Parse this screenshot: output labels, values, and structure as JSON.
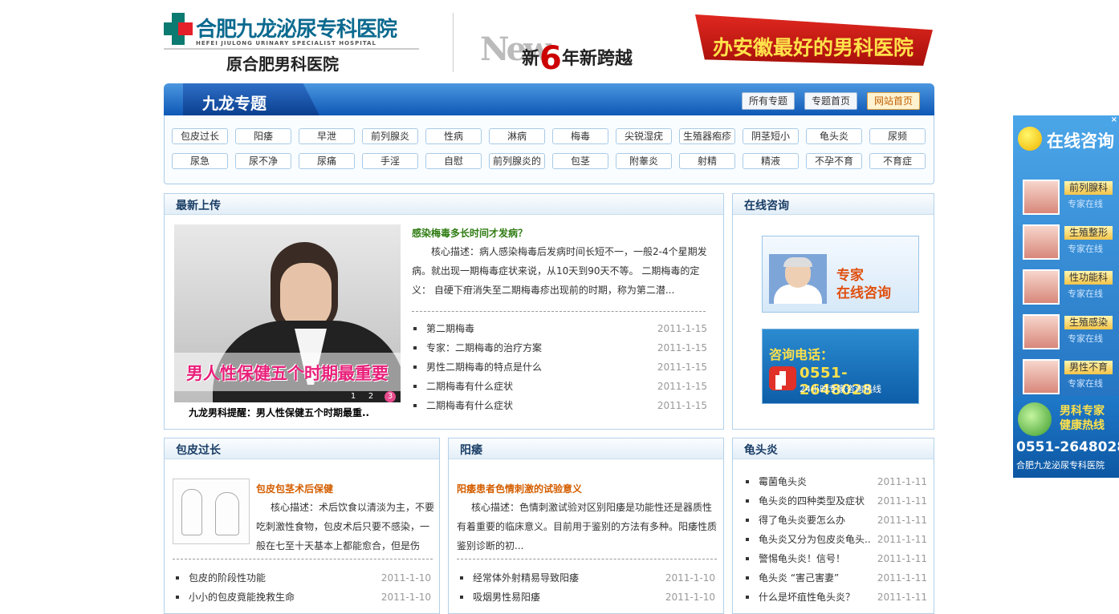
{
  "header": {
    "logo_name": "合肥九龙泌尿专科医院",
    "logo_en": "HEFEI JIULONG URINARY SPECIALIST HOSPITAL",
    "logo_sub": "原合肥男科医院",
    "banner_new": "New",
    "banner_slogan_a": "新",
    "banner_slogan_b": "年新",
    "banner_slogan_c": "跨越",
    "banner_num": "6",
    "banner_flag": "办安徽最好的男科医院"
  },
  "nav": {
    "title": "九龙专题",
    "buttons": [
      "所有专题",
      "专题首页",
      "网站首页"
    ]
  },
  "tags": [
    [
      "包皮过长",
      "阳痿",
      "早泄",
      "前列腺炎",
      "性病",
      "淋病",
      "梅毒",
      "尖锐湿疣",
      "生殖器疱疹",
      "阴茎短小",
      "龟头炎",
      "尿频"
    ],
    [
      "尿急",
      "尿不净",
      "尿痛",
      "手淫",
      "自慰",
      "前列腺炎的",
      "包茎",
      "附睾炎",
      "射精",
      "精液",
      "不孕不育",
      "不育症"
    ]
  ],
  "latest": {
    "title": "最新上传",
    "feature_caption_img": "男人性保健五个时期最重要",
    "feature_caption": "九龙男科提醒：男人性保健五个时期最重..",
    "pages": [
      "1",
      "2",
      "3"
    ],
    "article_title": "感染梅毒多长时间才发病？",
    "article_body": "核心描述：病人感染梅毒后发病时间长短不一，一般2-4个星期发病。就出现一期梅毒症状来说，从10天到90天不等。 二期梅毒的定义： 自硬下疳消失至二期梅毒疹出现前的时期，称为第二潜...",
    "list": [
      {
        "t": "第二期梅毒",
        "d": "2011-1-15"
      },
      {
        "t": "专家：二期梅毒的治疗方案",
        "d": "2011-1-15"
      },
      {
        "t": "男性二期梅毒的特点是什么",
        "d": "2011-1-15"
      },
      {
        "t": "二期梅毒有什么症状",
        "d": "2011-1-15"
      },
      {
        "t": "二期梅毒有什么症状",
        "d": "2011-1-15"
      }
    ]
  },
  "consult": {
    "title": "在线咨询",
    "card1_text": "专家\n在线咨询",
    "card1_a": "专家",
    "card1_b": "在线咨询",
    "card2_label": "咨询电话：",
    "card2_phone": "0551-2648028",
    "card2_sub": "24小时专家咨询热线"
  },
  "foreskin": {
    "title": "包皮过长",
    "article_title": "包皮包茎术后保健",
    "article_body": "核心描述：术后饮食以清淡为主，不要吃刺激性食物，包皮术后只要不感染，一般在七至十天基本上都能愈合，但是伤",
    "list": [
      {
        "t": "包皮的阶段性功能",
        "d": "2011-1-10"
      },
      {
        "t": "小小的包皮竟能挽救生命",
        "d": "2011-1-10"
      }
    ]
  },
  "impotence": {
    "title": "阳痿",
    "article_title": "阳痿患者色情刺激的试验意义",
    "article_body": "核心描述：色情刺激试验对区别阳痿是功能性还是器质性有着重要的临床意义。目前用于鉴别的方法有多种。阳痿性质鉴别诊断的初...",
    "list": [
      {
        "t": "经常体外射精易导致阳痿",
        "d": "2011-1-10"
      },
      {
        "t": "吸烟男性易阳痿",
        "d": "2011-1-10"
      }
    ]
  },
  "balanitis": {
    "title": "龟头炎",
    "list": [
      {
        "t": "霉菌龟头炎",
        "d": "2011-1-11"
      },
      {
        "t": "龟头炎的四种类型及症状",
        "d": "2011-1-11"
      },
      {
        "t": "得了龟头炎要怎么办",
        "d": "2011-1-11"
      },
      {
        "t": "龟头炎又分为包皮炎龟头..",
        "d": "2011-1-11"
      },
      {
        "t": "警惕龟头炎！信号！",
        "d": "2011-1-11"
      },
      {
        "t": "龟头炎 “害己害妻”",
        "d": "2011-1-11"
      },
      {
        "t": "什么是坏疽性龟头炎？",
        "d": "2011-1-11"
      }
    ]
  },
  "float": {
    "close": "×",
    "title": "在线咨询",
    "depts": [
      {
        "name": "前列腺科",
        "status": "专家在线"
      },
      {
        "name": "生殖整形",
        "status": "专家在线"
      },
      {
        "name": "性功能科",
        "status": "专家在线"
      },
      {
        "name": "生殖感染",
        "status": "专家在线"
      },
      {
        "name": "男性不育",
        "status": "专家在线"
      }
    ],
    "hotline_a": "男科专家",
    "hotline_b": "健康热线",
    "phone": "0551-2648028",
    "hospital": "合肥九龙泌尿专科医院"
  }
}
